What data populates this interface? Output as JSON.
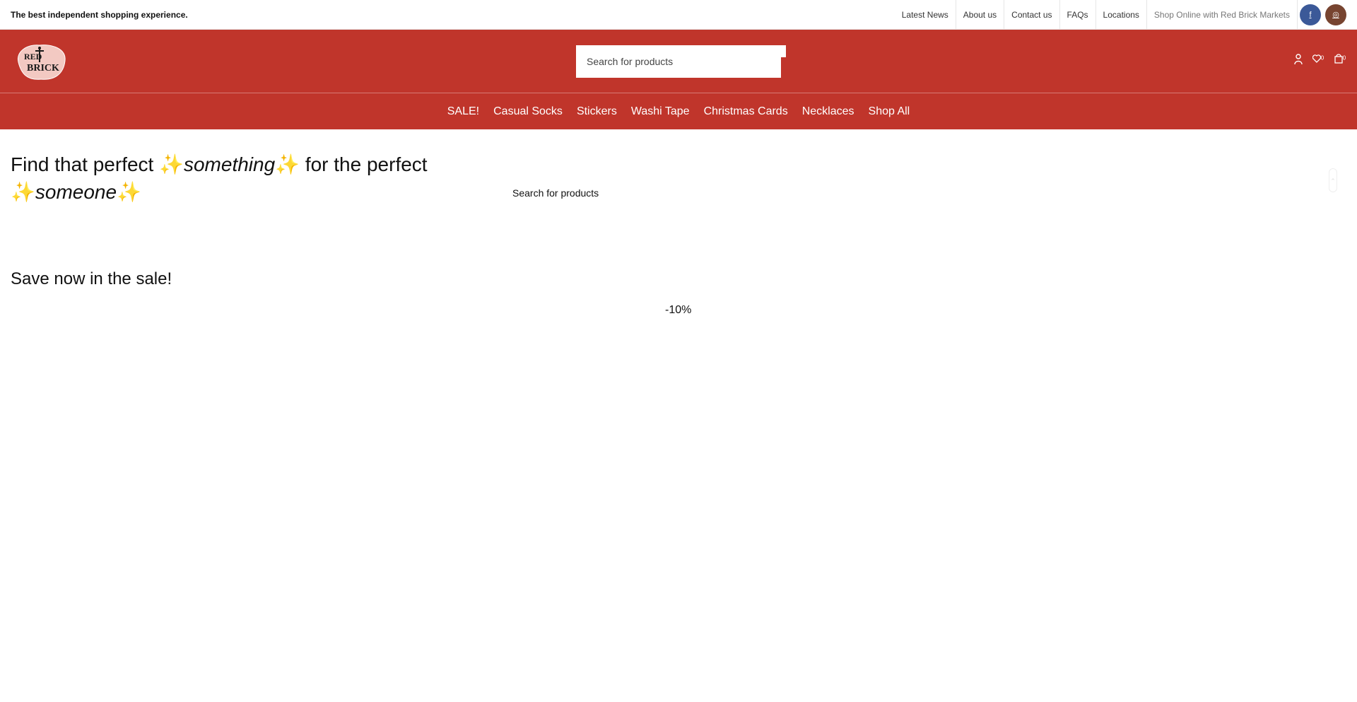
{
  "topbar": {
    "tagline": "The best independent shopping experience.",
    "links": [
      "Latest News",
      "About us",
      "Contact us",
      "FAQs",
      "Locations",
      "Shop Online with Red Brick Markets"
    ],
    "social_icons": [
      "facebook-icon",
      "instagram-icon"
    ]
  },
  "header": {
    "logo_text": "RED BRICK",
    "search": {
      "placeholder": "Search for products",
      "value": ""
    },
    "icons": [
      "account-icon",
      "wishlist-icon",
      "cart-icon"
    ],
    "wishlist_count": "0",
    "cart_count": "0"
  },
  "nav": {
    "items": [
      "SALE!",
      "Casual Socks",
      "Stickers",
      "Washi Tape",
      "Christmas Cards",
      "Necklaces",
      "Shop All"
    ]
  },
  "hero": {
    "title_part1": "Find that perfect ",
    "title_spark": "✨",
    "title_word1": "something",
    "title_part2": " for the perfect ",
    "title_word2": "someone",
    "search_label": "Search for products"
  },
  "sale": {
    "heading": "Save now in the sale!",
    "badge": "-10%"
  },
  "colors": {
    "brand_red": "#c0352b",
    "facebook": "#3b5998",
    "instagram": "#774430"
  }
}
